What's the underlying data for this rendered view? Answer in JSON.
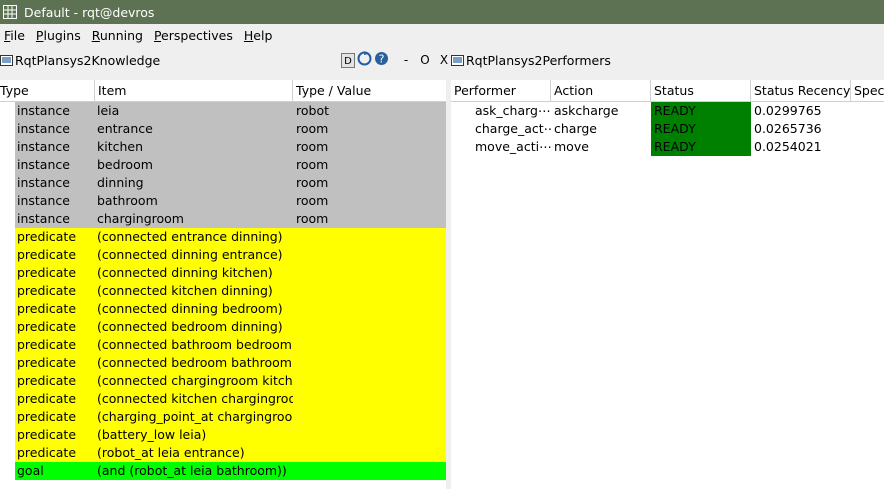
{
  "window": {
    "title": "Default - rqt@devros"
  },
  "menu": [
    {
      "label": "File",
      "mnemonic": "F",
      "rest": "ile"
    },
    {
      "label": "Plugins",
      "mnemonic": "P",
      "rest": "lugins"
    },
    {
      "label": "Running",
      "mnemonic": "R",
      "rest": "unning"
    },
    {
      "label": "Perspectives",
      "mnemonic": "P",
      "rest": "erspectives"
    },
    {
      "label": "Help",
      "mnemonic": "H",
      "rest": "elp"
    }
  ],
  "knowledge_panel": {
    "title": "RqtPlansys2Knowledge",
    "controls": {
      "d": "D",
      "minus": "-",
      "o": "O",
      "x": "X"
    },
    "headers": [
      "Type",
      "Item",
      "Type / Value"
    ],
    "rows": [
      {
        "type": "instance",
        "item": "leia",
        "value": "robot",
        "color": "#c0c0c0"
      },
      {
        "type": "instance",
        "item": "entrance",
        "value": "room",
        "color": "#c0c0c0"
      },
      {
        "type": "instance",
        "item": "kitchen",
        "value": "room",
        "color": "#c0c0c0"
      },
      {
        "type": "instance",
        "item": "bedroom",
        "value": "room",
        "color": "#c0c0c0"
      },
      {
        "type": "instance",
        "item": "dinning",
        "value": "room",
        "color": "#c0c0c0"
      },
      {
        "type": "instance",
        "item": "bathroom",
        "value": "room",
        "color": "#c0c0c0"
      },
      {
        "type": "instance",
        "item": "chargingroom",
        "value": "room",
        "color": "#c0c0c0"
      },
      {
        "type": "predicate",
        "item": "(connected entrance dinning)",
        "value": "",
        "color": "#ffff00"
      },
      {
        "type": "predicate",
        "item": "(connected dinning entrance)",
        "value": "",
        "color": "#ffff00"
      },
      {
        "type": "predicate",
        "item": "(connected dinning kitchen)",
        "value": "",
        "color": "#ffff00"
      },
      {
        "type": "predicate",
        "item": "(connected kitchen dinning)",
        "value": "",
        "color": "#ffff00"
      },
      {
        "type": "predicate",
        "item": "(connected dinning bedroom)",
        "value": "",
        "color": "#ffff00"
      },
      {
        "type": "predicate",
        "item": "(connected bedroom dinning)",
        "value": "",
        "color": "#ffff00"
      },
      {
        "type": "predicate",
        "item": "(connected bathroom bedroom)",
        "value": "",
        "color": "#ffff00"
      },
      {
        "type": "predicate",
        "item": "(connected bedroom bathroom)",
        "value": "",
        "color": "#ffff00"
      },
      {
        "type": "predicate",
        "item": "(connected chargingroom kitchen)",
        "value": "",
        "color": "#ffff00"
      },
      {
        "type": "predicate",
        "item": "(connected kitchen chargingroom)",
        "value": "",
        "color": "#ffff00"
      },
      {
        "type": "predicate",
        "item": "(charging_point_at chargingroom)",
        "value": "",
        "color": "#ffff00"
      },
      {
        "type": "predicate",
        "item": "(battery_low leia)",
        "value": "",
        "color": "#ffff00"
      },
      {
        "type": "predicate",
        "item": "(robot_at leia entrance)",
        "value": "",
        "color": "#ffff00"
      },
      {
        "type": "goal",
        "item": "(and (robot_at leia bathroom))",
        "value": "",
        "color": "#00ff00"
      }
    ]
  },
  "performers_panel": {
    "title": "RqtPlansys2Performers",
    "headers": [
      "Performer",
      "Action",
      "Status",
      "Status Recency",
      "Speci"
    ],
    "rows": [
      {
        "performer": "ask_charg⋯",
        "action": "askcharge",
        "status": "READY",
        "recency": "0.0299765",
        "spec": ""
      },
      {
        "performer": "charge_act⋯",
        "action": "charge",
        "status": "READY",
        "recency": "0.0265736",
        "spec": ""
      },
      {
        "performer": "move_acti⋯",
        "action": "move",
        "status": "READY",
        "recency": "0.0254021",
        "spec": ""
      }
    ],
    "status_color": "#008000"
  }
}
